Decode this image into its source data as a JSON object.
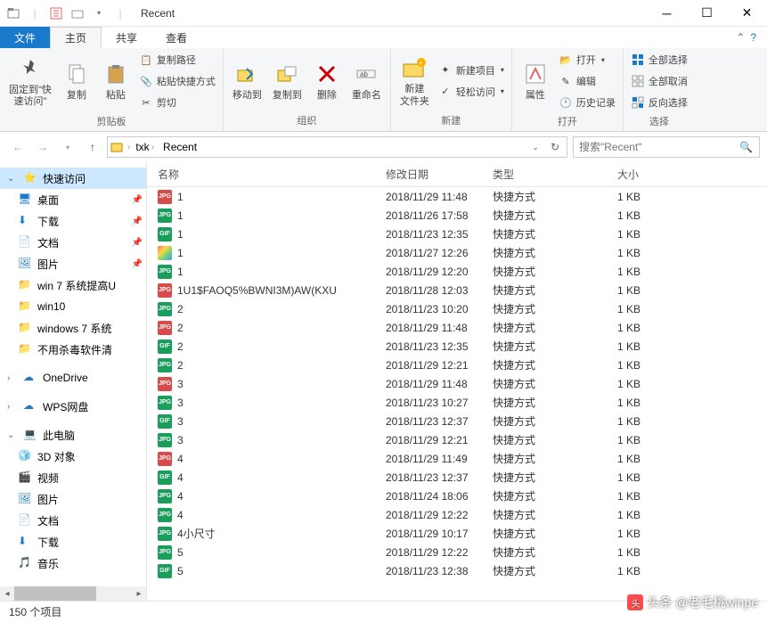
{
  "window": {
    "title": "Recent"
  },
  "tabs": {
    "file": "文件",
    "home": "主页",
    "share": "共享",
    "view": "查看"
  },
  "ribbon": {
    "pin": {
      "label": "固定到\"快\n速访问\""
    },
    "copy": "复制",
    "paste": "粘贴",
    "copypath": "复制路径",
    "pasteshortcut": "粘贴快捷方式",
    "cut": "剪切",
    "group_clipboard": "剪贴板",
    "moveto": "移动到",
    "copyto": "复制到",
    "delete": "删除",
    "rename": "重命名",
    "group_organize": "组织",
    "newfolder": "新建\n文件夹",
    "newitem": "新建项目",
    "easyaccess": "轻松访问",
    "group_new": "新建",
    "properties": "属性",
    "open": "打开",
    "edit": "编辑",
    "history": "历史记录",
    "group_open": "打开",
    "selectall": "全部选择",
    "selectnone": "全部取消",
    "invert": "反向选择",
    "group_select": "选择"
  },
  "breadcrumb": {
    "seg1": "txk",
    "seg2": "Recent"
  },
  "search": {
    "placeholder": "搜索\"Recent\""
  },
  "nav": {
    "quickaccess": "快速访问",
    "desktop": "桌面",
    "downloads": "下载",
    "documents": "文档",
    "pictures": "图片",
    "win7folder": "win 7 系统提高U",
    "win10folder": "win10",
    "windows7folder": "windows 7 系统",
    "novirus": "不用杀毒软件清",
    "onedrive": "OneDrive",
    "wps": "WPS网盘",
    "thispc": "此电脑",
    "objects3d": "3D 对象",
    "videos": "视频",
    "pictures2": "图片",
    "documents2": "文档",
    "downloads2": "下载",
    "music": "音乐"
  },
  "columns": {
    "name": "名称",
    "date": "修改日期",
    "type": "类型",
    "size": "大小"
  },
  "files": [
    {
      "ico": "jpg-red",
      "name": "1",
      "date": "2018/11/29 11:48",
      "type": "快捷方式",
      "size": "1 KB"
    },
    {
      "ico": "jpg",
      "name": "1",
      "date": "2018/11/26 17:58",
      "type": "快捷方式",
      "size": "1 KB"
    },
    {
      "ico": "gif",
      "name": "1",
      "date": "2018/11/23 12:35",
      "type": "快捷方式",
      "size": "1 KB"
    },
    {
      "ico": "img",
      "name": "1",
      "date": "2018/11/27 12:26",
      "type": "快捷方式",
      "size": "1 KB"
    },
    {
      "ico": "jpg",
      "name": "1",
      "date": "2018/11/29 12:20",
      "type": "快捷方式",
      "size": "1 KB"
    },
    {
      "ico": "jpg-red",
      "name": "1U1$FAOQ5%BWNI3M)AW(KXU",
      "date": "2018/11/28 12:03",
      "type": "快捷方式",
      "size": "1 KB"
    },
    {
      "ico": "jpg",
      "name": "2",
      "date": "2018/11/23 10:20",
      "type": "快捷方式",
      "size": "1 KB"
    },
    {
      "ico": "jpg-red",
      "name": "2",
      "date": "2018/11/29 11:48",
      "type": "快捷方式",
      "size": "1 KB"
    },
    {
      "ico": "gif",
      "name": "2",
      "date": "2018/11/23 12:35",
      "type": "快捷方式",
      "size": "1 KB"
    },
    {
      "ico": "jpg",
      "name": "2",
      "date": "2018/11/29 12:21",
      "type": "快捷方式",
      "size": "1 KB"
    },
    {
      "ico": "jpg-red",
      "name": "3",
      "date": "2018/11/29 11:48",
      "type": "快捷方式",
      "size": "1 KB"
    },
    {
      "ico": "jpg",
      "name": "3",
      "date": "2018/11/23 10:27",
      "type": "快捷方式",
      "size": "1 KB"
    },
    {
      "ico": "gif",
      "name": "3",
      "date": "2018/11/23 12:37",
      "type": "快捷方式",
      "size": "1 KB"
    },
    {
      "ico": "jpg",
      "name": "3",
      "date": "2018/11/29 12:21",
      "type": "快捷方式",
      "size": "1 KB"
    },
    {
      "ico": "jpg-red",
      "name": "4",
      "date": "2018/11/29 11:49",
      "type": "快捷方式",
      "size": "1 KB"
    },
    {
      "ico": "gif",
      "name": "4",
      "date": "2018/11/23 12:37",
      "type": "快捷方式",
      "size": "1 KB"
    },
    {
      "ico": "jpg",
      "name": "4",
      "date": "2018/11/24 18:06",
      "type": "快捷方式",
      "size": "1 KB"
    },
    {
      "ico": "jpg",
      "name": "4",
      "date": "2018/11/29 12:22",
      "type": "快捷方式",
      "size": "1 KB"
    },
    {
      "ico": "jpg",
      "name": "4小尺寸",
      "date": "2018/11/29 10:17",
      "type": "快捷方式",
      "size": "1 KB"
    },
    {
      "ico": "jpg",
      "name": "5",
      "date": "2018/11/29 12:22",
      "type": "快捷方式",
      "size": "1 KB"
    },
    {
      "ico": "gif",
      "name": "5",
      "date": "2018/11/23 12:38",
      "type": "快捷方式",
      "size": "1 KB"
    }
  ],
  "status": {
    "count": "150 个项目"
  },
  "watermark": "头条 @老毛桃winpe"
}
